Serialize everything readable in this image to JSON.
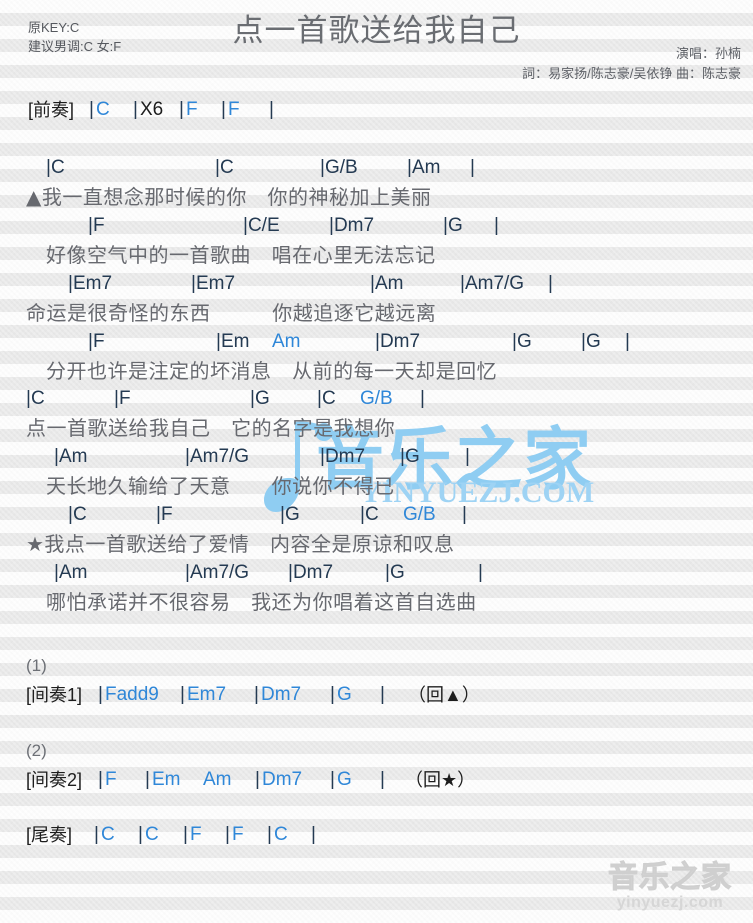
{
  "header": {
    "orig_key": "原KEY:C",
    "suggest_key": "建议男调:C 女:F",
    "title": "点一首歌送给我自己",
    "singer": "演唱：孙楠",
    "writers": "詞：易家扬/陈志豪/吴依铮  曲：陈志豪"
  },
  "colors": {
    "chord": "#2f87d8",
    "bar": "#243a52",
    "lyric": "#67696f",
    "title": "#6a6d72",
    "watermark_blue": "#8fcdf2",
    "watermark_gray": "#d8d8d8",
    "background": "#f1f1f1"
  },
  "watermarks": {
    "center_cn": "音乐之家",
    "center_url": "YINYUEZJ.COM",
    "corner_cn": "音乐之家",
    "corner_url": "yinyuezj.com"
  },
  "sections": {
    "intro": {
      "label": "[前奏]",
      "tokens": [
        "|",
        "C",
        "|",
        "X6",
        "|",
        "F",
        "|",
        "F",
        "|"
      ]
    },
    "verse1": {
      "chords_1": [
        "|C",
        "|C",
        "|G/B",
        "|Am",
        "|"
      ],
      "lyric_1": "▲我一直想念那时候的你   你的神秘加上美丽",
      "chords_2": [
        "|F",
        "|C/E",
        "|Dm7",
        "|G",
        "|"
      ],
      "lyric_2": "好像空气中的一首歌曲   唱在心里无法忘记",
      "chords_3": [
        "|Em7",
        "|Em7",
        "|Am",
        "|Am7/G",
        "|"
      ],
      "lyric_3": "命运是很奇怪的东西         你越追逐它越远离",
      "chords_4": [
        "|F",
        "|Em",
        "Am",
        "|Dm7",
        "|G",
        "|G",
        "|"
      ],
      "lyric_4": "分开也许是注定的坏消息   从前的每一天却是回忆"
    },
    "chorus": {
      "chords_1": [
        "|C",
        "|F",
        "|G",
        "|C",
        "G/B",
        "|"
      ],
      "lyric_1": "点一首歌送给我自己   它的名字是我想你",
      "chords_2": [
        "|Am",
        "|Am7/G",
        "|Dm7",
        "|G",
        "|"
      ],
      "lyric_2": "天长地久输给了天意      你说你不得已",
      "chords_3": [
        "|C",
        "|F",
        "|G",
        "|C",
        "G/B",
        "|"
      ],
      "lyric_3": "★我点一首歌送给了爱情   内容全是原谅和叹息",
      "chords_4": [
        "|Am",
        "|Am7/G",
        "|Dm7",
        "|G",
        "|"
      ],
      "lyric_4": "哪怕承诺并不很容易   我还为你唱着这首自选曲"
    },
    "interlude1": {
      "number": "(1)",
      "label": "[间奏1]",
      "tokens": [
        "|",
        "Fadd9",
        "|",
        "Em7",
        "|",
        "Dm7",
        "|",
        "G",
        "|"
      ],
      "repeat": "（回▲）"
    },
    "interlude2": {
      "number": "(2)",
      "label": "[间奏2]",
      "tokens": [
        "|",
        "F",
        "|",
        "Em",
        "Am",
        "|",
        "Dm7",
        "|",
        "G",
        "|"
      ],
      "repeat": "（回★）"
    },
    "outro": {
      "label": "[尾奏]",
      "tokens": [
        "|",
        "C",
        "|",
        "C",
        "|",
        "F",
        "|",
        "F",
        "|",
        "C",
        "|"
      ]
    }
  }
}
